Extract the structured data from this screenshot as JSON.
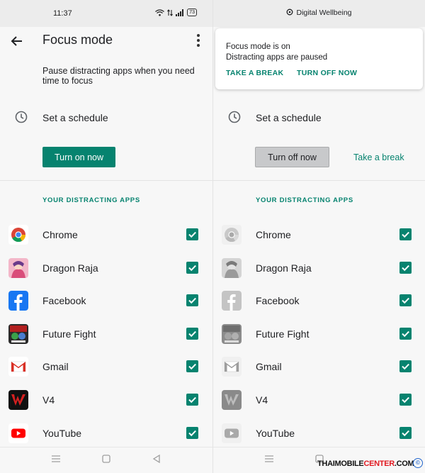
{
  "left": {
    "status_time": "11:37",
    "battery": "73",
    "title": "Focus mode",
    "description": "Pause distracting apps when you need time to focus",
    "schedule_label": "Set a schedule",
    "primary_button": "Turn on now",
    "section_header": "YOUR DISTRACTING APPS"
  },
  "right": {
    "header": "Digital Wellbeing",
    "notification": {
      "line1": "Focus mode is on",
      "line2": "Distracting apps are paused",
      "action1": "TAKE A BREAK",
      "action2": "TURN OFF NOW"
    },
    "schedule_label": "Set a schedule",
    "primary_button": "Turn off now",
    "secondary_link": "Take a break",
    "section_header": "YOUR DISTRACTING APPS"
  },
  "apps": [
    {
      "name": "Chrome",
      "icon": "chrome-icon",
      "checked": true
    },
    {
      "name": "Dragon Raja",
      "icon": "dragon-raja-icon",
      "checked": true
    },
    {
      "name": "Facebook",
      "icon": "facebook-icon",
      "checked": true
    },
    {
      "name": "Future Fight",
      "icon": "future-fight-icon",
      "checked": true
    },
    {
      "name": "Gmail",
      "icon": "gmail-icon",
      "checked": true
    },
    {
      "name": "V4",
      "icon": "v4-icon",
      "checked": true
    },
    {
      "name": "YouTube",
      "icon": "youtube-icon",
      "checked": true
    }
  ],
  "watermark": {
    "part1": "THAIMOBILE",
    "part2": "CENTER",
    "part3": ".COM",
    "symbol": "©"
  },
  "colors": {
    "accent": "#06836f",
    "background": "#f7f7f7",
    "disabled_button": "#c8c9cb"
  }
}
